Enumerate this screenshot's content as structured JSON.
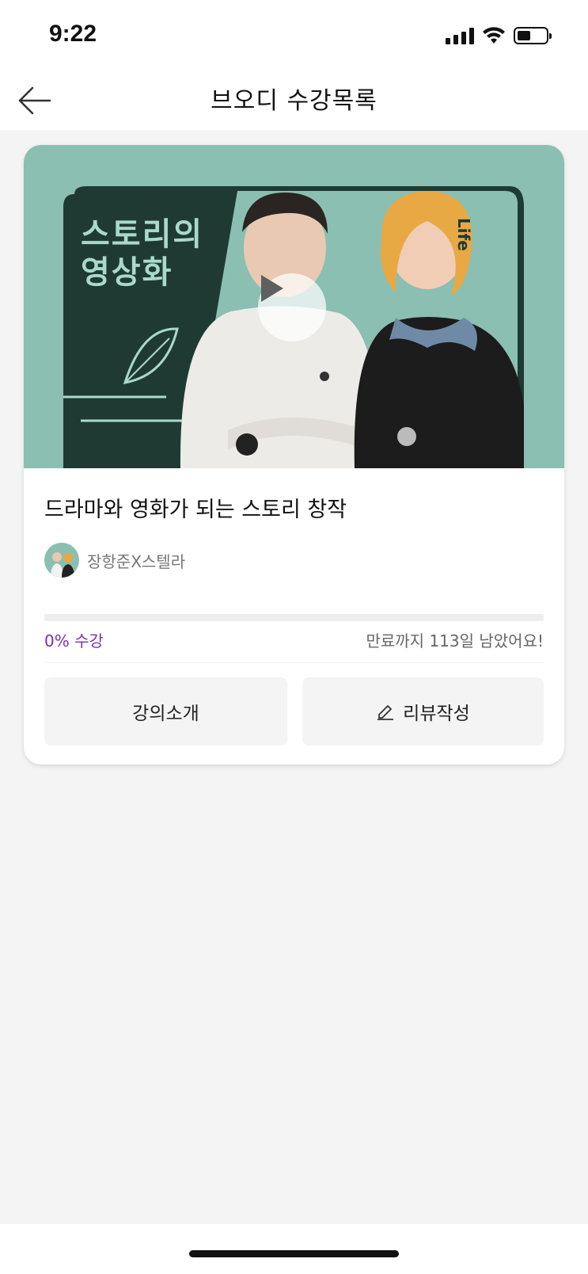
{
  "status_bar": {
    "time": "9:22"
  },
  "header": {
    "title": "브오디 수강목록",
    "back_icon": "arrow-left-icon"
  },
  "course": {
    "thumbnail": {
      "title_line1": "스토리의",
      "title_line2": "영상화",
      "brand": "Life",
      "bg_color": "#8bbfb2",
      "panel_color": "#1f3a33"
    },
    "title": "드라마와 영화가 되는 스토리 창작",
    "instructor": "장항준X스텔라",
    "progress_percent": 0,
    "progress_label": "0% 수강",
    "expiry_text": "만료까지 113일 남았어요!",
    "buttons": {
      "intro": "강의소개",
      "review": "리뷰작성"
    }
  },
  "colors": {
    "accent": "#7a2fb8",
    "background": "#f4f4f4"
  }
}
